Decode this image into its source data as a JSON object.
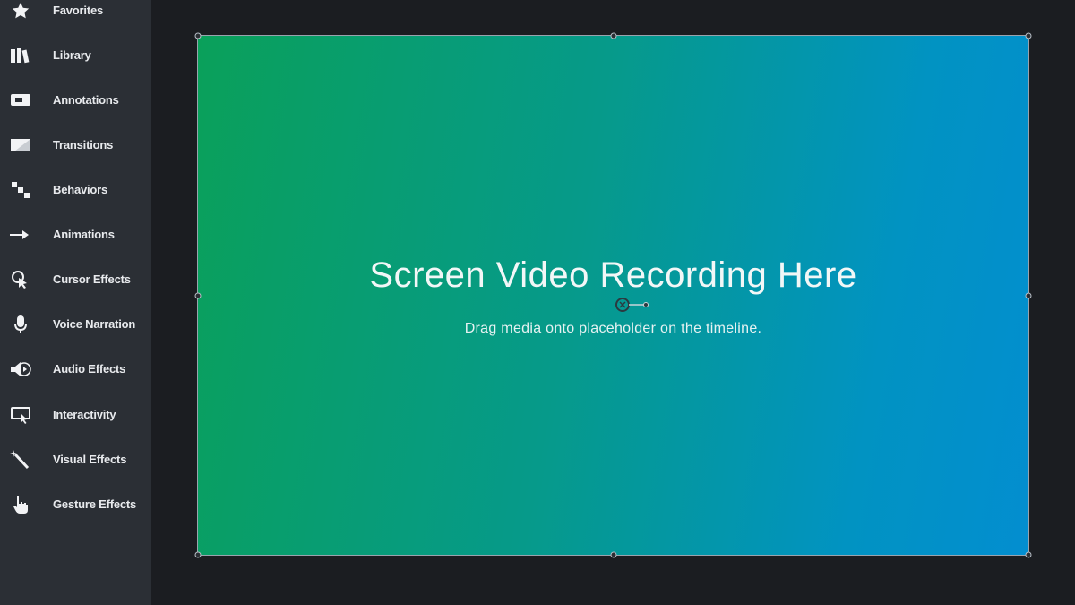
{
  "sidebar": {
    "items": [
      {
        "label": "Favorites",
        "icon": "star-icon"
      },
      {
        "label": "Library",
        "icon": "library-icon"
      },
      {
        "label": "Annotations",
        "icon": "annotation-icon"
      },
      {
        "label": "Transitions",
        "icon": "transition-icon"
      },
      {
        "label": "Behaviors",
        "icon": "behaviors-icon"
      },
      {
        "label": "Animations",
        "icon": "animation-icon"
      },
      {
        "label": "Cursor Effects",
        "icon": "cursor-icon"
      },
      {
        "label": "Voice Narration",
        "icon": "microphone-icon"
      },
      {
        "label": "Audio Effects",
        "icon": "speaker-icon"
      },
      {
        "label": "Interactivity",
        "icon": "interactivity-icon"
      },
      {
        "label": "Visual Effects",
        "icon": "magic-wand-icon"
      },
      {
        "label": "Gesture Effects",
        "icon": "hand-pointer-icon"
      }
    ]
  },
  "canvas": {
    "title": "Screen Video Recording Here",
    "subtitle": "Drag media onto placeholder on the timeline."
  },
  "colors": {
    "sidebar_bg": "#2b2f35",
    "stage_bg": "#1b1d21",
    "gradient_start": "#0aa05a",
    "gradient_end": "#038ed0"
  }
}
